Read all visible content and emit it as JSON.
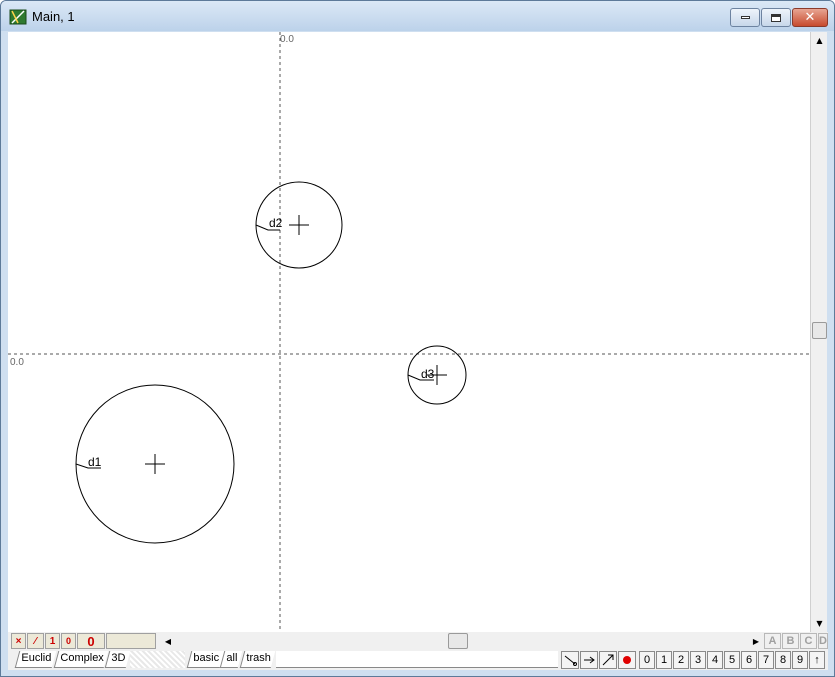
{
  "window": {
    "title": "Main, 1"
  },
  "canvas": {
    "origin_label_top": "0.0",
    "origin_label_left": "0.0",
    "circles": [
      {
        "name": "d1",
        "label": "d1"
      },
      {
        "name": "d2",
        "label": "d2"
      },
      {
        "name": "d3",
        "label": "d3"
      }
    ]
  },
  "status_row": {
    "x_btn": "×",
    "line_btn": "⁄",
    "one_btn": "1",
    "zero_btn": "0",
    "big_zero": "0"
  },
  "letter_buttons": [
    "A",
    "B",
    "C",
    "D"
  ],
  "tabs_left": [
    "Euclid",
    "Complex",
    "3D"
  ],
  "tabs_right": [
    "basic",
    "all",
    "trash"
  ],
  "number_buttons": [
    "0",
    "1",
    "2",
    "3",
    "4",
    "5",
    "6",
    "7",
    "8",
    "9",
    "↑"
  ],
  "colors": {
    "accent_red": "#cc0000",
    "title_bar": "#bcd2ea"
  }
}
